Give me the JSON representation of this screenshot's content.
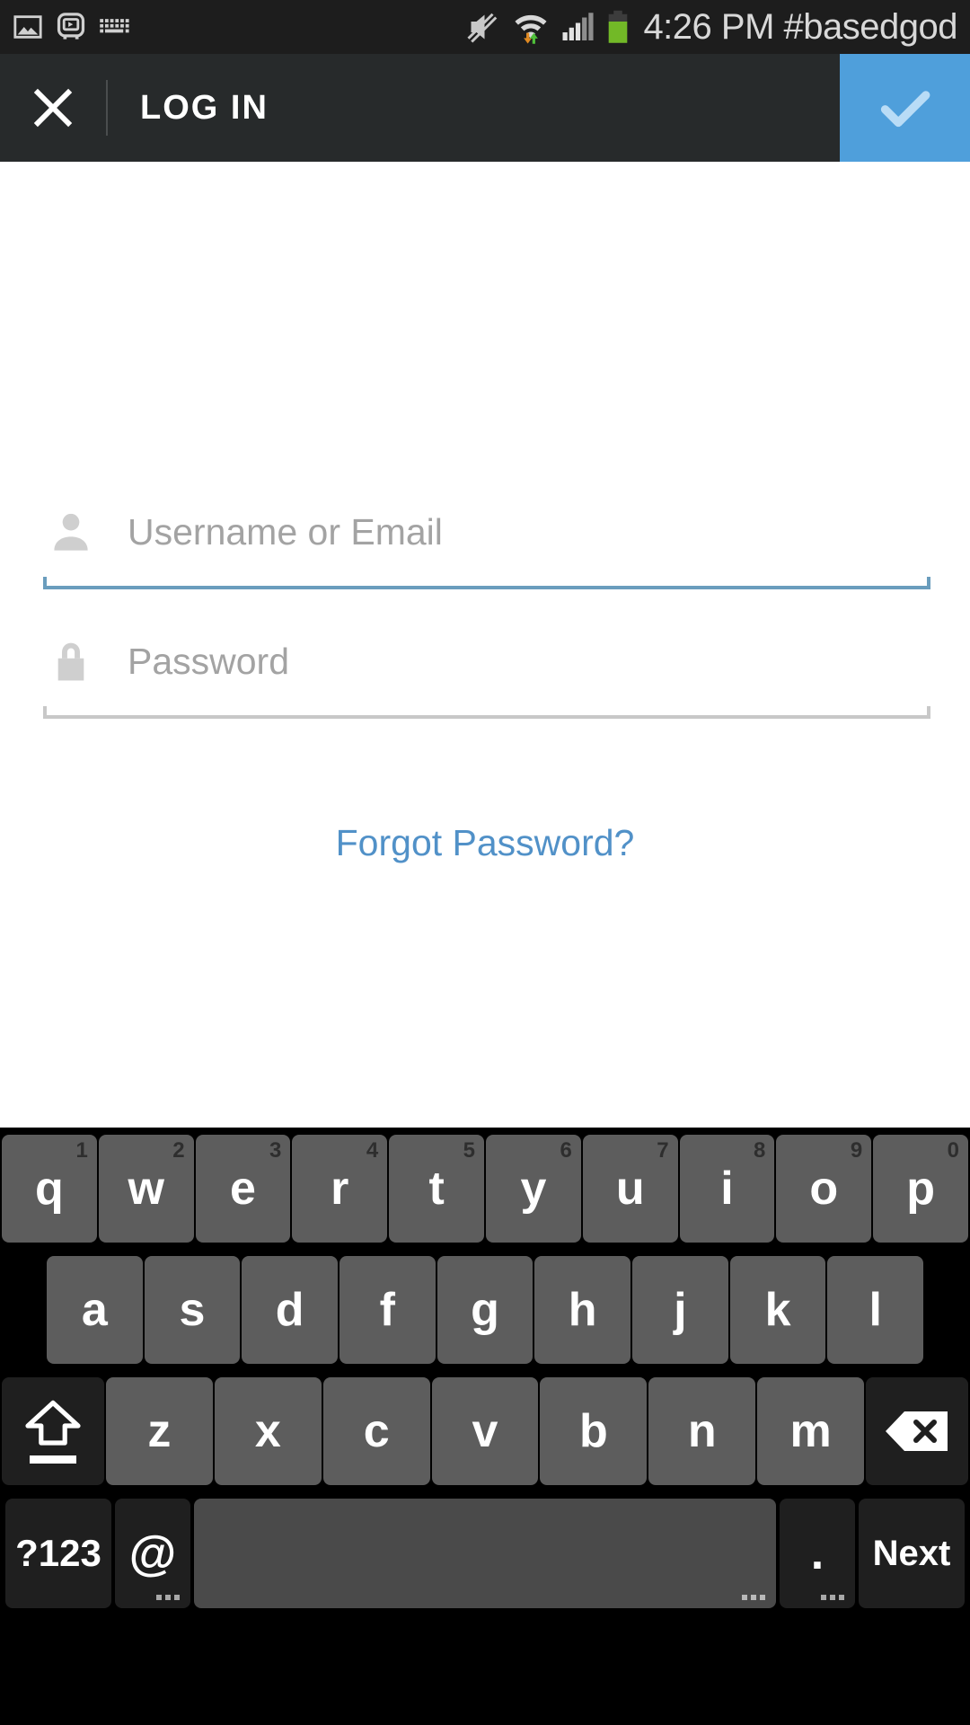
{
  "statusbar": {
    "time": "4:26 PM",
    "label": "#basedgod",
    "icons": [
      "image-icon",
      "video-badge-icon",
      "keyboard-icon",
      "volume-muted-icon",
      "wifi-data-icon",
      "cellular-signal-icon",
      "battery-icon"
    ]
  },
  "actionbar": {
    "close_label": "✕",
    "title": "LOG IN",
    "submit_label": "✓",
    "accent_color": "#4f9fdb",
    "background_color": "#272a2b"
  },
  "form": {
    "username": {
      "placeholder": "Username or Email",
      "value": "",
      "icon": "person-icon",
      "focused": true,
      "underline_color": "#6a9dbd"
    },
    "password": {
      "placeholder": "Password",
      "value": "",
      "icon": "lock-icon",
      "focused": false,
      "underline_color": "#c8c8c8"
    },
    "forgot_password_label": "Forgot Password?",
    "link_color": "#5191c8"
  },
  "keyboard": {
    "row1": [
      {
        "label": "q",
        "hint": "1"
      },
      {
        "label": "w",
        "hint": "2"
      },
      {
        "label": "e",
        "hint": "3"
      },
      {
        "label": "r",
        "hint": "4"
      },
      {
        "label": "t",
        "hint": "5"
      },
      {
        "label": "y",
        "hint": "6"
      },
      {
        "label": "u",
        "hint": "7"
      },
      {
        "label": "i",
        "hint": "8"
      },
      {
        "label": "o",
        "hint": "9"
      },
      {
        "label": "p",
        "hint": "0"
      }
    ],
    "row2": [
      {
        "label": "a"
      },
      {
        "label": "s"
      },
      {
        "label": "d"
      },
      {
        "label": "f"
      },
      {
        "label": "g"
      },
      {
        "label": "h"
      },
      {
        "label": "j"
      },
      {
        "label": "k"
      },
      {
        "label": "l"
      }
    ],
    "row3": [
      {
        "label": "z"
      },
      {
        "label": "x"
      },
      {
        "label": "c"
      },
      {
        "label": "v"
      },
      {
        "label": "b"
      },
      {
        "label": "n"
      },
      {
        "label": "m"
      }
    ],
    "shift_label": "",
    "backspace_label": "",
    "symbols_label": "?123",
    "at_label": "@",
    "space_label": "",
    "period_label": ".",
    "action_label": "Next"
  }
}
